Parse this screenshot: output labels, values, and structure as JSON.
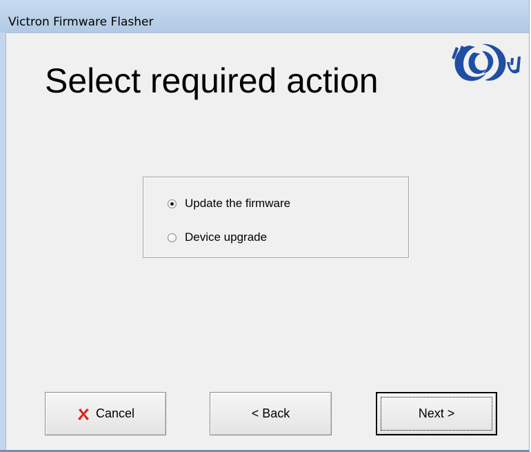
{
  "window": {
    "title": "Victron Firmware Flasher"
  },
  "main": {
    "heading": "Select required action",
    "logo_icon": "victron-logo-icon",
    "options": [
      {
        "label": "Update the firmware",
        "checked": true
      },
      {
        "label": "Device upgrade",
        "checked": false
      }
    ]
  },
  "buttons": {
    "cancel_label": "Cancel",
    "cancel_icon": "red-x-icon",
    "back_label": "< Back",
    "next_label": "Next >"
  },
  "colors": {
    "titlebar": "#bcd3ea",
    "logo_blue": "#1f4ea3",
    "cancel_red": "#d9261c",
    "background": "#f0f0f0"
  }
}
